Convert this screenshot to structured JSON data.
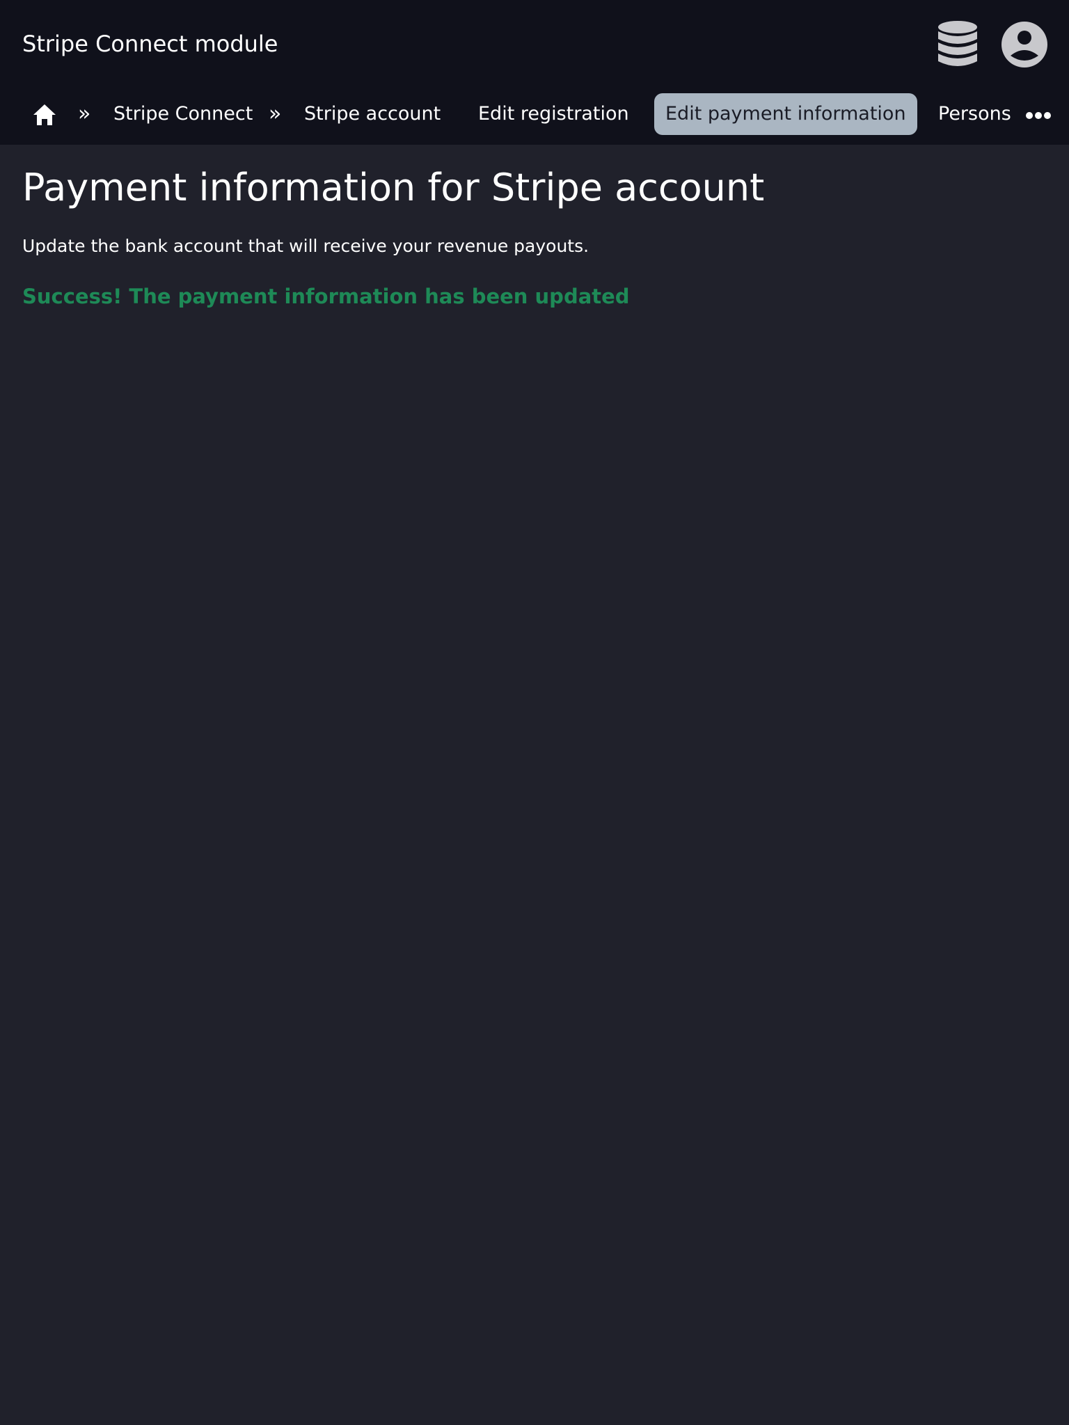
{
  "header": {
    "app_title": "Stripe Connect module",
    "icons": [
      "database-icon",
      "user-account-icon"
    ]
  },
  "nav": {
    "home_icon": "home-icon",
    "separator": "»",
    "breadcrumb": [
      "Stripe Connect",
      "Stripe account"
    ],
    "tabs": [
      {
        "label": "Edit registration",
        "active": false
      },
      {
        "label": "Edit payment information",
        "active": true
      },
      {
        "label": "Persons",
        "active": false
      }
    ],
    "more_icon": "more-horizontal-icon"
  },
  "main": {
    "title": "Payment information for Stripe account",
    "intro": "Update the bank account that will receive your revenue payouts.",
    "success_message": "Success! The payment information has been updated"
  },
  "colors": {
    "header_bg": "#10111b",
    "page_bg": "#20212b",
    "active_tab_bg": "#aab6c2",
    "success": "#1e8a57",
    "icon": "#c8c8cc"
  }
}
